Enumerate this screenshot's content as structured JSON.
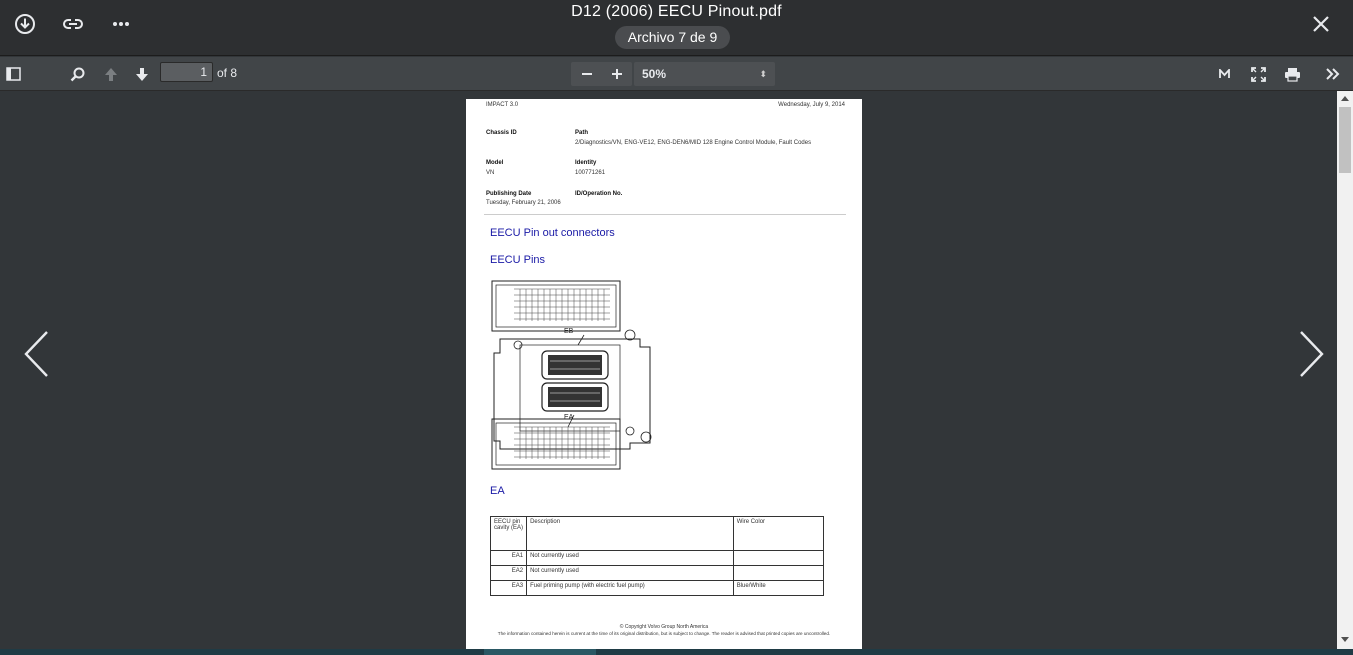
{
  "topbar": {
    "title": "D12 (2006) EECU Pinout.pdf",
    "counter": "Archivo 7 de 9",
    "icons": [
      "download-icon",
      "link-icon",
      "more-icon",
      "close-icon"
    ]
  },
  "toolbar": {
    "page_value": "1",
    "page_of": "of 8",
    "zoom_value": "50%",
    "zoom_arrow": "⬍",
    "icons": [
      "sidebar-toggle-icon",
      "search-icon",
      "arrow-up-icon",
      "arrow-down-icon",
      "zoom-out-icon",
      "zoom-in-icon",
      "presentation-mode-icon",
      "fullscreen-icon",
      "print-icon",
      "tools-menu-icon"
    ]
  },
  "document": {
    "header_left": "IMPACT 3.0",
    "header_right": "Wednesday, July 9, 2014",
    "chassis_label": "Chassis ID",
    "path_label": "Path",
    "path_value": "2/Diagnostics/VN, ENG-VE12, ENG-DEN6/MID 128 Engine Control Module, Fault Codes",
    "model_label": "Model",
    "model_value": "VN",
    "identity_label": "Identity",
    "identity_value": "100771261",
    "pubdate_label": "Publishing Date",
    "pubdate_value": "Tuesday, February 21, 2006",
    "idop_label": "ID/Operation No.",
    "heading1": "EECU Pin out connectors",
    "heading2": "EECU Pins",
    "diagram_eb": "EB",
    "diagram_ea": "EA",
    "heading3": "EA",
    "table": {
      "headers": [
        "EECU pin cavity (EA)",
        "Description",
        "Wire Color"
      ],
      "rows": [
        [
          "EA1",
          "Not currently used",
          ""
        ],
        [
          "EA2",
          "Not currently used",
          ""
        ],
        [
          "EA3",
          "Fuel priming pump (with electric fuel pump)",
          "Blue/White"
        ]
      ]
    },
    "footer1": "© Copyright Volvo Group North America",
    "footer2": "The information contained herein is current at the time of its original distribution, but is subject to change. The reader is advised that printed copies are uncontrolled."
  },
  "colors": {
    "background": "#323639",
    "topbar": "#2d2f31",
    "toolbar": "#414548",
    "heading_blue": "#1a1aa6"
  }
}
